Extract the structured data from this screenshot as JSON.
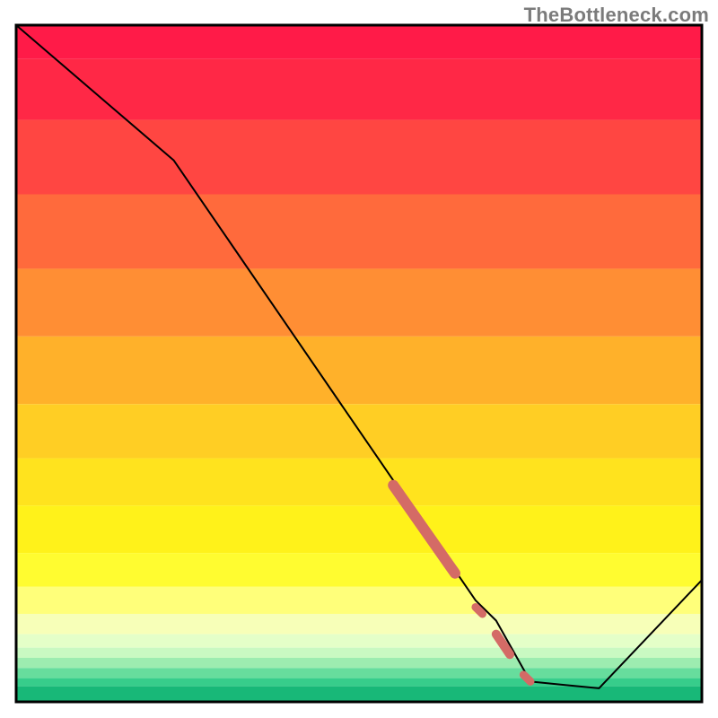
{
  "watermark": "TheBottleneck.com",
  "chart_data": {
    "type": "line",
    "title": "",
    "xlabel": "",
    "ylabel": "",
    "xlim": [
      0,
      100
    ],
    "ylim": [
      0,
      100
    ],
    "grid": false,
    "legend": false,
    "x": [
      0,
      23,
      67,
      70,
      75,
      85,
      100
    ],
    "y": [
      100,
      80,
      15,
      12,
      3,
      2,
      18
    ],
    "line_color": "#000000",
    "line_width": 2,
    "highlight_segments": [
      {
        "x0": 55,
        "y0": 32,
        "x1": 64,
        "y1": 19,
        "color": "#d46b66",
        "width": 12
      },
      {
        "x0": 67,
        "y0": 14,
        "x1": 68,
        "y1": 13,
        "color": "#d46b66",
        "width": 9
      },
      {
        "x0": 70,
        "y0": 10,
        "x1": 72,
        "y1": 7,
        "color": "#d46b66",
        "width": 10
      },
      {
        "x0": 74,
        "y0": 4,
        "x1": 75,
        "y1": 3,
        "color": "#d46b66",
        "width": 9
      }
    ],
    "background_bands": [
      {
        "y0": 100,
        "y1": 95,
        "color": "#ff1b48"
      },
      {
        "y0": 95,
        "y1": 86,
        "color": "#ff2846"
      },
      {
        "y0": 86,
        "y1": 75,
        "color": "#ff4642"
      },
      {
        "y0": 75,
        "y1": 64,
        "color": "#ff6a3c"
      },
      {
        "y0": 64,
        "y1": 54,
        "color": "#ff8e34"
      },
      {
        "y0": 54,
        "y1": 44,
        "color": "#ffb12a"
      },
      {
        "y0": 44,
        "y1": 36,
        "color": "#ffce24"
      },
      {
        "y0": 36,
        "y1": 29,
        "color": "#ffe31e"
      },
      {
        "y0": 29,
        "y1": 22,
        "color": "#fff21a"
      },
      {
        "y0": 22,
        "y1": 17,
        "color": "#fffc30"
      },
      {
        "y0": 17,
        "y1": 13,
        "color": "#ffff7a"
      },
      {
        "y0": 13,
        "y1": 10,
        "color": "#f7ffb8"
      },
      {
        "y0": 10,
        "y1": 8,
        "color": "#e4ffc8"
      },
      {
        "y0": 8,
        "y1": 6.5,
        "color": "#c9f9c2"
      },
      {
        "y0": 6.5,
        "y1": 5,
        "color": "#9decb0"
      },
      {
        "y0": 5,
        "y1": 3.5,
        "color": "#67dd9d"
      },
      {
        "y0": 3.5,
        "y1": 2.3,
        "color": "#37cd8b"
      },
      {
        "y0": 2.3,
        "y1": 0,
        "color": "#18b878"
      }
    ],
    "border_color": "#000000",
    "border_width": 3
  }
}
